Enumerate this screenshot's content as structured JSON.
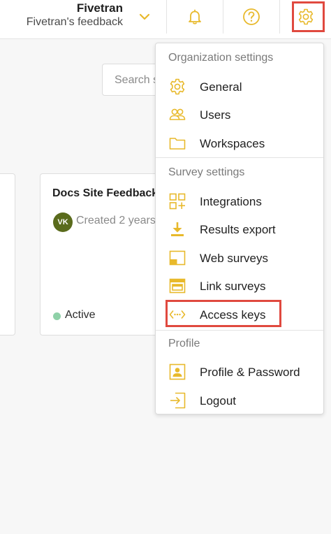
{
  "header": {
    "org_name": "Fivetran",
    "org_subtitle": "Fivetran's feedback",
    "icons": [
      "chevron-down-icon",
      "bell-icon",
      "help-icon",
      "gear-icon"
    ]
  },
  "search": {
    "placeholder": "Search s"
  },
  "survey_card": {
    "title": "Docs Site Feedback",
    "avatar_initials": "VK",
    "created": "Created 2 years",
    "status": "Active"
  },
  "menu": {
    "organization": {
      "heading": "Organization settings",
      "items": [
        {
          "label": "General",
          "icon": "gear-icon"
        },
        {
          "label": "Users",
          "icon": "users-icon"
        },
        {
          "label": "Workspaces",
          "icon": "folder-icon"
        }
      ]
    },
    "survey": {
      "heading": "Survey settings",
      "items": [
        {
          "label": "Integrations",
          "icon": "integrations-icon"
        },
        {
          "label": "Results export",
          "icon": "download-icon"
        },
        {
          "label": "Web surveys",
          "icon": "web-survey-icon"
        },
        {
          "label": "Link surveys",
          "icon": "link-survey-icon"
        },
        {
          "label": "Access keys",
          "icon": "access-keys-icon"
        }
      ]
    },
    "profile": {
      "heading": "Profile",
      "items": [
        {
          "label": "Profile & Password",
          "icon": "profile-icon"
        },
        {
          "label": "Logout",
          "icon": "logout-icon"
        }
      ]
    }
  },
  "colors": {
    "accent": "#e8b92b",
    "highlight": "#e0493f",
    "active_dot": "#8fd1a8",
    "avatar": "#5a6b1c"
  }
}
